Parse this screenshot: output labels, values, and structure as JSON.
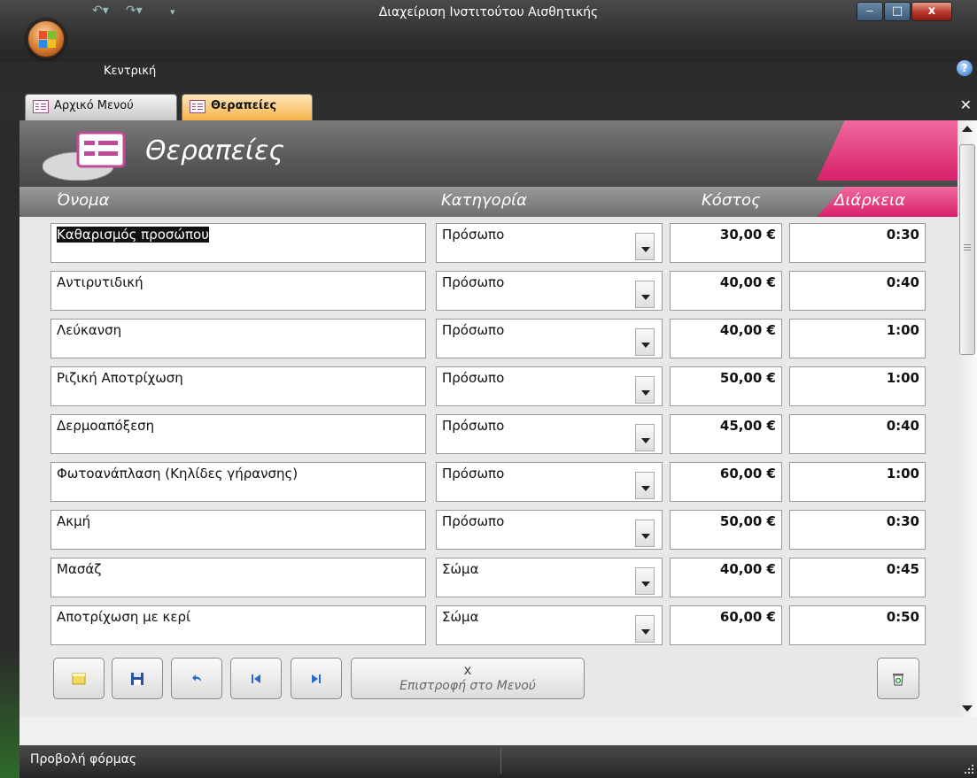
{
  "window": {
    "title": "Διαχείριση Ινστιτούτου Αισθητικής"
  },
  "ribbon": {
    "tab": "Κεντρική"
  },
  "doc_tabs": [
    {
      "label": "Αρχικό Μενού",
      "active": false
    },
    {
      "label": "Θεραπείες",
      "active": true
    }
  ],
  "form": {
    "title": "Θεραπείες",
    "columns": {
      "name": "Όνομα",
      "category": "Κατηγορία",
      "cost": "Κόστος",
      "duration": "Διάρκεια"
    },
    "rows": [
      {
        "name": "Καθαρισμός προσώπου",
        "category": "Πρόσωπο",
        "cost": "30,00 €",
        "duration": "0:30"
      },
      {
        "name": "Αντιρυτιδική",
        "category": "Πρόσωπο",
        "cost": "40,00 €",
        "duration": "0:40"
      },
      {
        "name": "Λεύκανση",
        "category": "Πρόσωπο",
        "cost": "40,00 €",
        "duration": "1:00"
      },
      {
        "name": "Ριζική Αποτρίχωση",
        "category": "Πρόσωπο",
        "cost": "50,00 €",
        "duration": "1:00"
      },
      {
        "name": "Δερμοαπόξεση",
        "category": "Πρόσωπο",
        "cost": "45,00 €",
        "duration": "0:40"
      },
      {
        "name": "Φωτοανάπλαση (Κηλίδες γήρανσης)",
        "category": "Πρόσωπο",
        "cost": "60,00 €",
        "duration": "1:00"
      },
      {
        "name": "Ακμή",
        "category": "Πρόσωπο",
        "cost": "50,00 €",
        "duration": "0:30"
      },
      {
        "name": "Μασάζ",
        "category": "Σώμα",
        "cost": "40,00 €",
        "duration": "0:45"
      },
      {
        "name": "Αποτρίχωση με κερί",
        "category": "Σώμα",
        "cost": "60,00 €",
        "duration": "0:50"
      }
    ],
    "footer": {
      "return_x": "x",
      "return_label": "Επιστροφή στο Μενού"
    }
  },
  "statusbar": {
    "text": "Προβολή φόρμας"
  },
  "colors": {
    "accent_pink": "#e0327a",
    "tab_active": "#f6b24a"
  }
}
